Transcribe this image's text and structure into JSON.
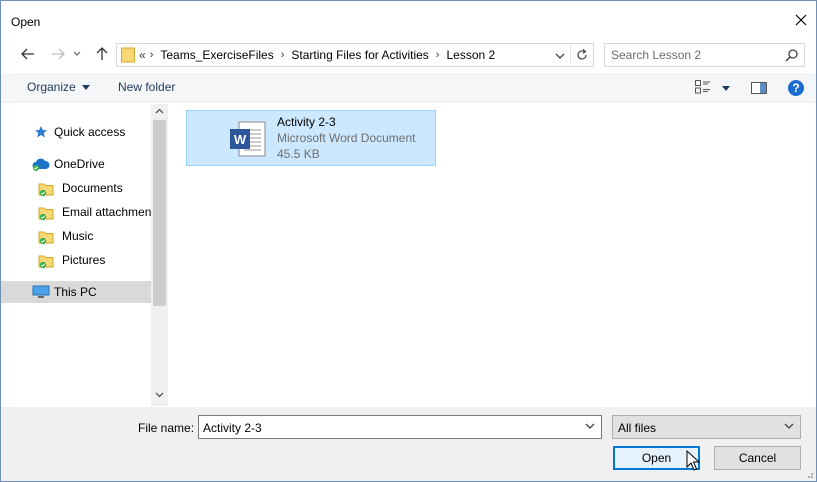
{
  "window": {
    "title": "Open",
    "close_label": "Close"
  },
  "address": {
    "overflow": "«",
    "crumbs": [
      "Teams_ExerciseFiles",
      "Starting Files for Activities",
      "Lesson 2"
    ]
  },
  "search": {
    "placeholder": "Search Lesson 2"
  },
  "toolbar": {
    "organize_label": "Organize",
    "new_folder_label": "New folder",
    "help_label": "?"
  },
  "nav": {
    "items": [
      {
        "label": "Quick access",
        "icon": "quick-access-star-icon"
      },
      {
        "label": "OneDrive",
        "icon": "onedrive-cloud-icon"
      },
      {
        "label": "Documents",
        "icon": "synced-folder-icon"
      },
      {
        "label": "Email attachmen",
        "icon": "synced-folder-icon"
      },
      {
        "label": "Music",
        "icon": "synced-folder-icon"
      },
      {
        "label": "Pictures",
        "icon": "synced-folder-icon"
      },
      {
        "label": "This PC",
        "icon": "computer-icon",
        "selected": true
      }
    ]
  },
  "files": [
    {
      "name": "Activity 2-3",
      "type": "Microsoft Word Document",
      "size": "45.5 KB",
      "icon": "word-document-icon",
      "selected": true
    }
  ],
  "bottom": {
    "file_name_label": "File name:",
    "file_name_value": "Activity 2-3",
    "file_type_value": "All files",
    "open_label": "Open",
    "cancel_label": "Cancel"
  },
  "colors": {
    "selection_bg": "#cce8ff",
    "selection_border": "#99d1ff",
    "accent": "#0078d7",
    "word_blue": "#2b579a",
    "folder_yellow": "#f8d775",
    "sync_green": "#3ab44a"
  }
}
